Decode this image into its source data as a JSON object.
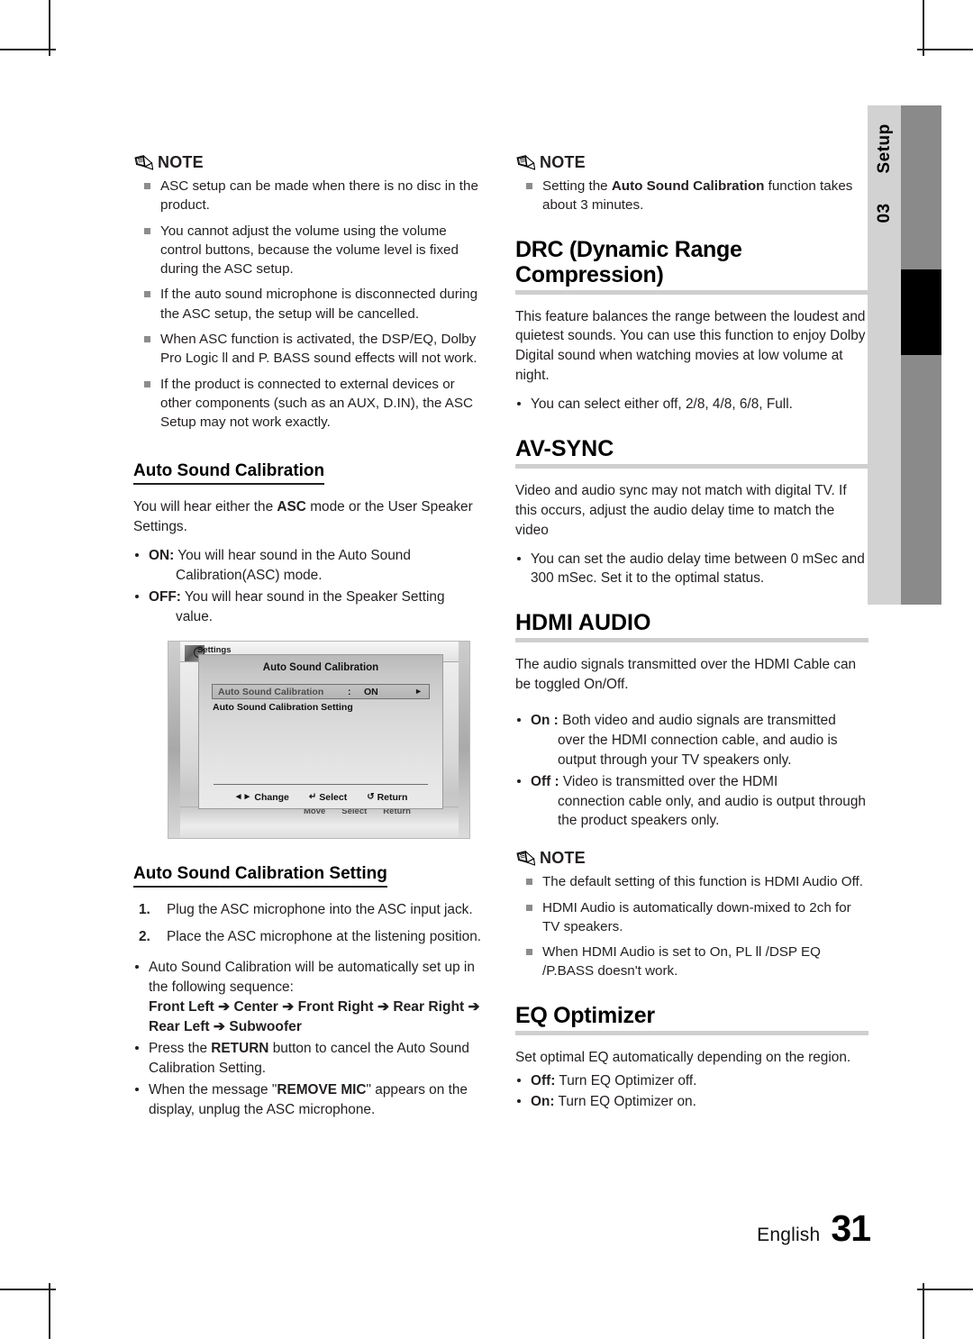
{
  "page": {
    "language_label": "English",
    "page_number": "31",
    "side_tab_number": "03",
    "side_tab_label": "Setup"
  },
  "left_column": {
    "note1": {
      "title": "NOTE",
      "icon": "pencil-icon",
      "items": [
        "ASC setup can be made when there is no disc in the product.",
        "You cannot adjust the volume using the volume control buttons, because the volume level is fixed during the ASC setup.",
        "If the auto sound microphone is disconnected during the ASC setup, the setup will be cancelled.",
        "When ASC function is activated, the DSP/EQ, Dolby Pro Logic ll and P. BASS sound effects will not work.",
        "If the product is connected to external devices or other components (such as an AUX, D.IN), the ASC Setup may not work exactly."
      ]
    },
    "auto_sound_calibration": {
      "heading": "Auto Sound Calibration",
      "intro_prefix": "You will hear either the ",
      "intro_bold": "ASC",
      "intro_suffix": " mode or the User Speaker Settings.",
      "options": [
        {
          "label": "ON:",
          "text": "You will hear sound in the Auto Sound",
          "cont": "Calibration(ASC) mode."
        },
        {
          "label": "OFF:",
          "text": "You will hear sound in the Speaker Setting",
          "cont": "value."
        }
      ]
    },
    "screenshot": {
      "background": {
        "settings_label": "Settings",
        "hints": [
          "Move",
          "Select",
          "Return"
        ]
      },
      "dialog": {
        "title": "Auto Sound Calibration",
        "row_selected": {
          "label": "Auto Sound Calibration",
          "colon": ":",
          "value": "ON",
          "arrow": "►"
        },
        "row_second": "Auto Sound Calibration Setting",
        "footer": [
          {
            "glyph": "◄►",
            "label": "Change"
          },
          {
            "glyph": "↵",
            "label": "Select"
          },
          {
            "glyph": "↺",
            "label": "Return"
          }
        ]
      }
    },
    "asc_setting": {
      "heading": "Auto Sound Calibration Setting",
      "steps": [
        {
          "num": "1.",
          "text": "Plug the ASC microphone into the ASC input jack."
        },
        {
          "num": "2.",
          "text": "Place the ASC microphone at the listening position."
        }
      ],
      "bullets": [
        {
          "text": "Auto Sound Calibration will be automatically set up in the following sequence:",
          "sequence": "Front Left ➔ Center ➔ Front Right ➔ Rear Right ➔ Rear Left ➔ Subwoofer"
        },
        {
          "prefix": "Press the ",
          "bold": "RETURN",
          "suffix": " button to cancel the Auto Sound Calibration Setting."
        },
        {
          "prefix": "When the message \"",
          "bold": "REMOVE MIC",
          "suffix": "\" appears on the display, unplug the ASC microphone."
        }
      ]
    }
  },
  "right_column": {
    "note1": {
      "title": "NOTE",
      "icon": "pencil-icon",
      "item_prefix": "Setting the ",
      "item_bold": "Auto Sound Calibration",
      "item_suffix": " function takes about 3 minutes."
    },
    "drc": {
      "heading": "DRC (Dynamic Range Compression)",
      "body": "This feature balances the range between the loudest and quietest sounds. You can use this function to enjoy Dolby Digital sound when watching movies at low volume at night.",
      "bullet": "You can select either off, 2/8, 4/8, 6/8, Full."
    },
    "av_sync": {
      "heading": "AV-SYNC",
      "body": "Video and audio sync may not match with digital TV. If this occurs, adjust the audio delay time to match the video",
      "bullet": "You can set the audio delay time between 0 mSec and 300 mSec. Set it to the optimal status."
    },
    "hdmi_audio": {
      "heading": "HDMI AUDIO",
      "body": "The audio signals transmitted over the HDMI Cable can be toggled On/Off.",
      "options": [
        {
          "label": "On :",
          "text": "Both video and audio signals are transmitted",
          "cont": "over the HDMI connection cable, and audio is output through your TV speakers only."
        },
        {
          "label": "Off :",
          "text": "Video is transmitted over the HDMI",
          "cont": "connection cable only, and audio is output through the product speakers only."
        }
      ],
      "note": {
        "title": "NOTE",
        "icon": "pencil-icon",
        "items": [
          "The default setting of this function is HDMI Audio Off.",
          "HDMI Audio is automatically down-mixed to 2ch for TV speakers.",
          "When HDMI Audio is set to On, PL ll /DSP EQ /P.BASS doesn't work."
        ]
      }
    },
    "eq_optimizer": {
      "heading": "EQ Optimizer",
      "body": "Set optimal EQ automatically depending on the region.",
      "options": [
        {
          "label": "Off:",
          "text": "Turn EQ Optimizer off."
        },
        {
          "label": "On:",
          "text": "Turn EQ Optimizer on."
        }
      ]
    }
  }
}
